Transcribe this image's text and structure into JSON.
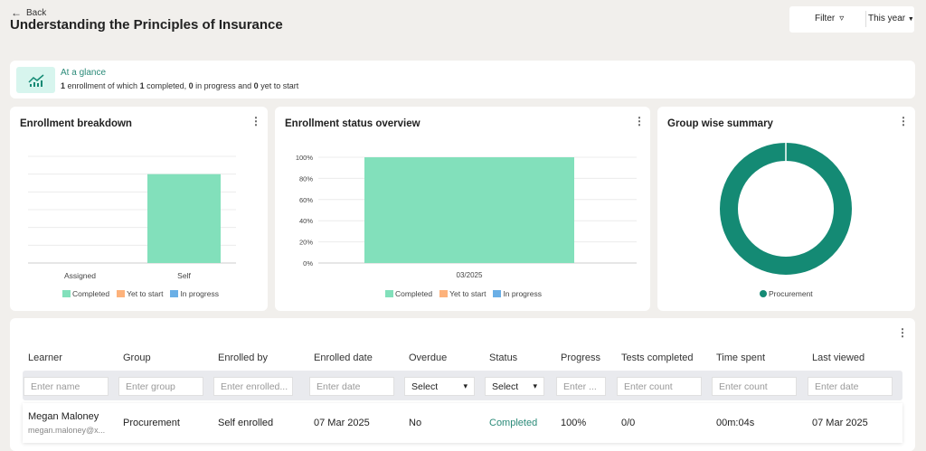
{
  "header": {
    "back_label": "Back",
    "title": "Understanding the Principles of Insurance",
    "filter_label": "Filter",
    "period": "This year"
  },
  "glance": {
    "title": "At a glance",
    "parts": [
      "1",
      " enrollment of which ",
      "1",
      " completed, ",
      "0",
      " in progress and ",
      "0",
      " yet to start"
    ]
  },
  "colors": {
    "completed": "#82e0bb",
    "yet_to_start": "#fdb27b",
    "in_progress": "#6aafe6",
    "donut": "#148a74",
    "accent": "#2a8a78"
  },
  "legend": {
    "completed": "Completed",
    "yet_to_start": "Yet to start",
    "in_progress": "In progress"
  },
  "chart_data": [
    {
      "title": "Enrollment breakdown",
      "type": "bar",
      "categories": [
        "Assigned",
        "Self"
      ],
      "series": [
        {
          "name": "Completed",
          "values": [
            0,
            1
          ]
        },
        {
          "name": "Yet to start",
          "values": [
            0,
            0
          ]
        },
        {
          "name": "In progress",
          "values": [
            0,
            0
          ]
        }
      ],
      "ylim": [
        0,
        1.2
      ],
      "grid": true,
      "legend": "bottom"
    },
    {
      "title": "Enrollment status overview",
      "type": "bar",
      "categories": [
        "03/2025"
      ],
      "series": [
        {
          "name": "Completed",
          "values": [
            100
          ]
        },
        {
          "name": "Yet to start",
          "values": [
            0
          ]
        },
        {
          "name": "In progress",
          "values": [
            0
          ]
        }
      ],
      "yticks": [
        "0%",
        "20%",
        "40%",
        "60%",
        "80%",
        "100%"
      ],
      "ylim": [
        0,
        100
      ],
      "grid": true,
      "legend": "bottom"
    },
    {
      "title": "Group wise summary",
      "type": "pie",
      "labels": [
        "Procurement"
      ],
      "values": [
        1
      ],
      "legend": "bottom"
    }
  ],
  "table": {
    "headers": [
      "Learner",
      "Group",
      "Enrolled by",
      "Enrolled date",
      "Overdue",
      "Status",
      "Progress",
      "Tests completed",
      "Time spent",
      "Last viewed"
    ],
    "filters": [
      "Enter name",
      "Enter group",
      "Enter enrolled...",
      "Enter date",
      "Select",
      "Select",
      "Enter ...",
      "Enter count",
      "Enter count",
      "Enter date"
    ],
    "rows": [
      {
        "name": "Megan Maloney",
        "email": "megan.maloney@x...",
        "group": "Procurement",
        "enrolled_by": "Self enrolled",
        "enrolled_date": "07 Mar 2025",
        "overdue": "No",
        "status": "Completed",
        "progress": "100%",
        "tests": "0/0",
        "time": "00m:04s",
        "last_viewed": "07 Mar 2025"
      }
    ]
  }
}
